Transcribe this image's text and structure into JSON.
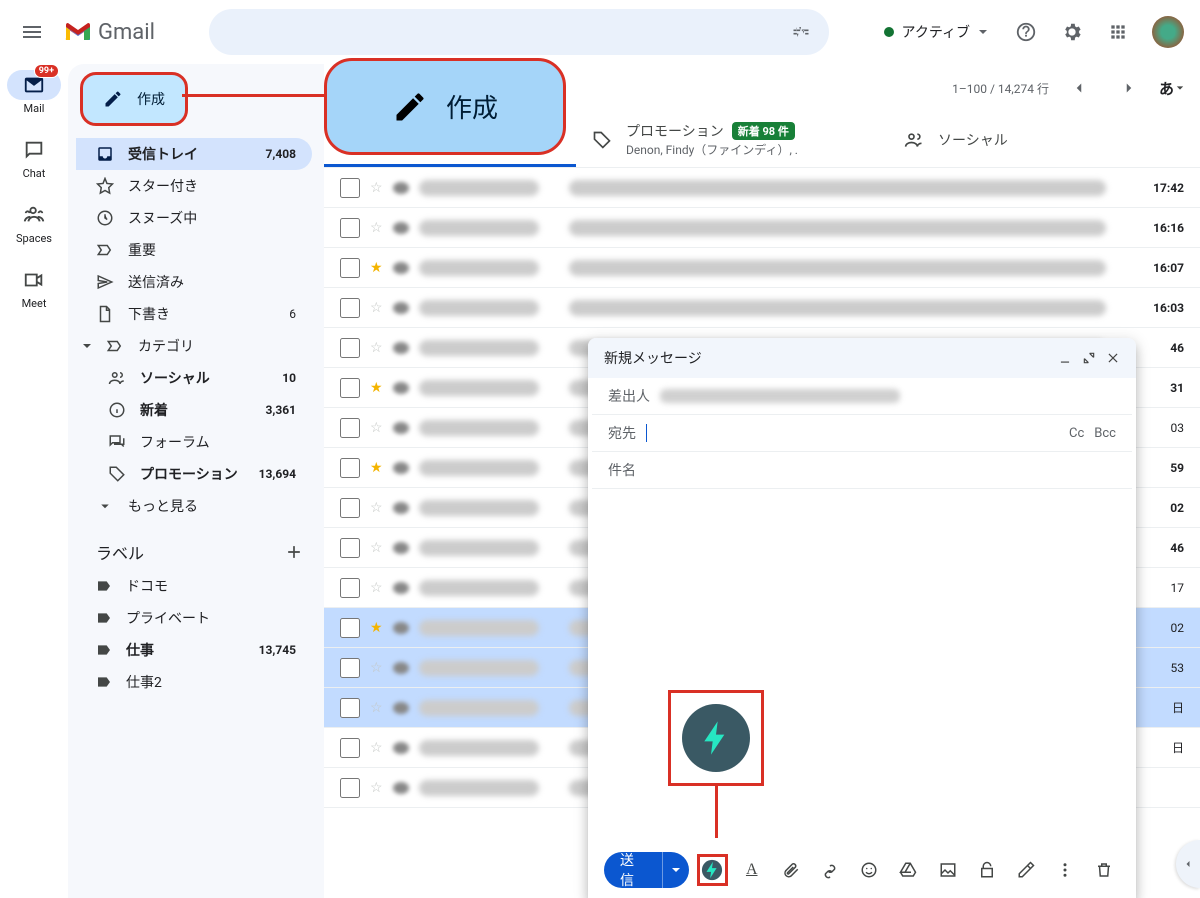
{
  "header": {
    "logo": "Gmail",
    "status": "アクティブ",
    "lang": "あ"
  },
  "rail": {
    "mail": "Mail",
    "mail_badge": "99+",
    "chat": "Chat",
    "spaces": "Spaces",
    "meet": "Meet"
  },
  "sidebar": {
    "compose": "作成",
    "inbox": {
      "label": "受信トレイ",
      "count": "7,408"
    },
    "starred": "スター付き",
    "snoozed": "スヌーズ中",
    "important": "重要",
    "sent": "送信済み",
    "drafts": {
      "label": "下書き",
      "count": "6"
    },
    "categories": "カテゴリ",
    "social": {
      "label": "ソーシャル",
      "count": "10"
    },
    "updates": {
      "label": "新着",
      "count": "3,361"
    },
    "forums": "フォーラム",
    "promotions": {
      "label": "プロモーション",
      "count": "13,694"
    },
    "more": "もっと見る",
    "labels_heading": "ラベル",
    "labels": {
      "docomo": "ドコモ",
      "private": "プライベート",
      "work": {
        "label": "仕事",
        "count": "13,745"
      },
      "work2": "仕事2"
    }
  },
  "paginate": {
    "range": "1–100 / 14,274 行"
  },
  "tabs": {
    "promo": {
      "title": "プロモーション",
      "badge": "新着 98 件",
      "sub": "Denon, Findy（ファインディ）, ."
    },
    "social": "ソーシャル"
  },
  "rows": [
    {
      "time": "17:42",
      "star": false,
      "unread": true
    },
    {
      "time": "16:16",
      "star": false,
      "unread": true
    },
    {
      "time": "16:07",
      "star": true,
      "unread": true
    },
    {
      "time": "16:03",
      "star": false,
      "unread": true
    },
    {
      "time": "46",
      "star": false,
      "unread": true
    },
    {
      "time": "31",
      "star": true,
      "unread": true
    },
    {
      "time": "03",
      "star": false,
      "unread": false
    },
    {
      "time": "59",
      "star": true,
      "unread": true
    },
    {
      "time": "02",
      "star": false,
      "unread": true
    },
    {
      "time": "46",
      "star": false,
      "unread": true
    },
    {
      "time": "17",
      "star": false,
      "unread": false
    },
    {
      "time": "02",
      "star": true,
      "selected": true
    },
    {
      "time": "53",
      "star": false,
      "selected": true
    },
    {
      "time": "日",
      "star": false,
      "selected": true
    },
    {
      "time": "日",
      "star": false,
      "unread": false
    },
    {
      "time": "",
      "star": false,
      "unread": true
    }
  ],
  "compose_popup": {
    "title": "新規メッセージ",
    "from_label": "差出人",
    "to_label": "宛先",
    "cc": "Cc",
    "bcc": "Bcc",
    "subject_placeholder": "件名",
    "send": "送信"
  },
  "callout": {
    "compose_big": "作成"
  }
}
